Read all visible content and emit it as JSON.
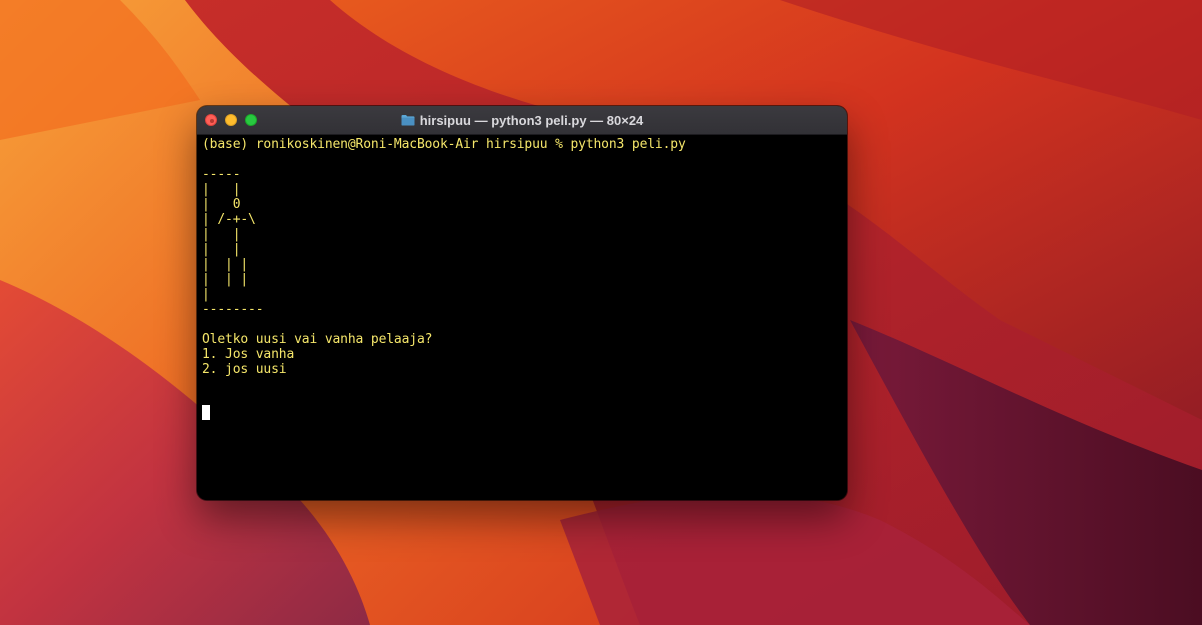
{
  "desktop": {
    "wallpaper_colors": [
      "#e8501c",
      "#f47b25",
      "#c9222a",
      "#8a1a2c",
      "#5a0f25",
      "#f09a3a"
    ]
  },
  "window": {
    "title": "hirsipuu — python3 peli.py — 80×24",
    "title_icon": "folder-icon",
    "buttons": {
      "close": "close-button",
      "minimize": "minimize-button",
      "zoom": "zoom-button"
    }
  },
  "terminal": {
    "text_color": "#f5e66a",
    "background": "#000000",
    "output": "(base) ronikoskinen@Roni-MacBook-Air hirsipuu % python3 peli.py\n\n-----\n|   |\n|   0\n| /-+-\\\n|   |\n|   |\n|  | |\n|  | |\n|\n--------\n\nOletko uusi vai vanha pelaaja?\n1. Jos vanha\n2. jos uusi"
  }
}
